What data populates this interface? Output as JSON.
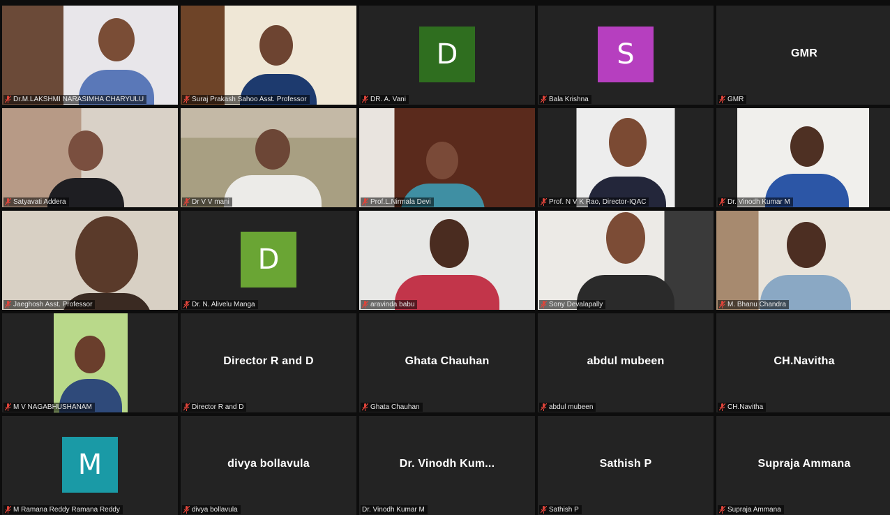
{
  "participants": [
    {
      "label": "Dr.M.LAKSHMI NARASIMHA CHARYULU",
      "kind": "video"
    },
    {
      "label": "Suraj Prakash Sahoo Asst. Professor",
      "kind": "video"
    },
    {
      "label": "DR. A. Vani",
      "kind": "avatar",
      "initial": "D",
      "color": "#2f6e1f"
    },
    {
      "label": "Bala Krishna",
      "kind": "avatar",
      "initial": "S",
      "color": "#b63fbf"
    },
    {
      "label": "GMR",
      "kind": "name",
      "display": "GMR"
    },
    {
      "label": "Satyavati Addera",
      "kind": "video"
    },
    {
      "label": "Dr V V mani",
      "kind": "video"
    },
    {
      "label": "Prof.L.Nirmala Devi",
      "kind": "video"
    },
    {
      "label": "Prof. N V K Rao, Director-IQAC",
      "kind": "video"
    },
    {
      "label": "Dr. Vinodh Kumar M",
      "kind": "video"
    },
    {
      "label": "Jaeghosh Asst. Professor",
      "kind": "video"
    },
    {
      "label": "Dr. N. Alivelu Manga",
      "kind": "avatar",
      "initial": "D",
      "color": "#6aa534"
    },
    {
      "label": "aravinda babu",
      "kind": "video"
    },
    {
      "label": "Sony Devalapally",
      "kind": "video"
    },
    {
      "label": "M. Bhanu Chandra",
      "kind": "video"
    },
    {
      "label": "M V NAGABHUSHANAM",
      "kind": "video"
    },
    {
      "label": "Director R and D",
      "kind": "name",
      "display": "Director R and D"
    },
    {
      "label": "Ghata Chauhan",
      "kind": "name",
      "display": "Ghata Chauhan"
    },
    {
      "label": "abdul mubeen",
      "kind": "name",
      "display": "abdul mubeen"
    },
    {
      "label": "CH.Navitha",
      "kind": "name",
      "display": "CH.Navitha"
    },
    {
      "label": "M Ramana Reddy Ramana Reddy",
      "kind": "avatar",
      "initial": "M",
      "color": "#1a9aa6"
    },
    {
      "label": "divya bollavula",
      "kind": "name",
      "display": "divya bollavula"
    },
    {
      "label": "Dr. Vinodh Kumar M",
      "kind": "name",
      "display": "Dr. Vinodh Kum...",
      "muted": false
    },
    {
      "label": "Sathish P",
      "kind": "name",
      "display": "Sathish P"
    },
    {
      "label": "Supraja Ammana",
      "kind": "name",
      "display": "Supraja Ammana"
    }
  ],
  "icons": {
    "muted": "mic-muted-icon"
  },
  "colors": {
    "background": "#0d0d0d",
    "tile": "#232323",
    "muted_icon": "#e0443a"
  }
}
